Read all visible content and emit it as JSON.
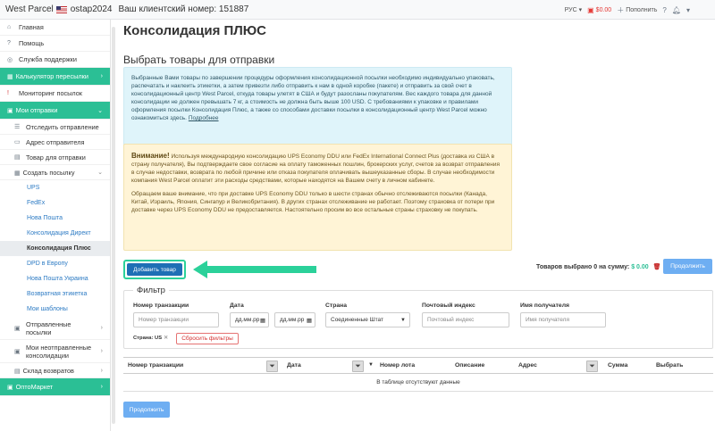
{
  "topbar": {
    "brand": "West Parcel",
    "username": "ostap2024",
    "account": "Ваш клиентский номер: 151887",
    "lang": "РУС",
    "balance": "$0.00",
    "topup": "Пополнить"
  },
  "sidebar": {
    "items": [
      {
        "label": "Главная",
        "icon": "home-icon"
      },
      {
        "label": "Помощь",
        "icon": "question-icon"
      },
      {
        "label": "Служба поддержки",
        "icon": "support-icon"
      },
      {
        "label": "Калькулятор пересылки",
        "icon": "calculator-icon"
      },
      {
        "label": "Мониторинг посылок",
        "icon": "alert-icon"
      },
      {
        "label": "Мои отправки",
        "icon": "box-icon"
      },
      {
        "label": "Отследить отправление",
        "icon": "track-icon"
      },
      {
        "label": "Адрес отправителя",
        "icon": "address-icon"
      },
      {
        "label": "Товар для отправки",
        "icon": "product-icon"
      },
      {
        "label": "Создать посылку",
        "icon": "package-icon"
      },
      {
        "label": "UPS"
      },
      {
        "label": "FedEx"
      },
      {
        "label": "Нова Пошта"
      },
      {
        "label": "Консолидация Директ"
      },
      {
        "label": "Консолидация Плюс"
      },
      {
        "label": "DPD в Европу"
      },
      {
        "label": "Нова Пошта Украина"
      },
      {
        "label": "Возвратная этикетка"
      },
      {
        "label": "Мои шаблоны"
      },
      {
        "label": "Отправленные посылки",
        "icon": "sent-icon"
      },
      {
        "label": "Мои неотправленные консолидации",
        "icon": "unsent-icon"
      },
      {
        "label": "Склад возвратов",
        "icon": "warehouse-icon"
      },
      {
        "label": "ОптоМаркет",
        "icon": "market-icon"
      }
    ]
  },
  "main": {
    "title": "Консолидация ПЛЮС",
    "subtitle": "Выбрать товары для отправки",
    "info_text": "Выбранные Вами товары по завершении процедуры оформления консолидационной посылки необходимо индивидуально упаковать, распечатать и наклеить этикетки, а затем привезти либо отправить к нам в одной коробке (пакете) и отправить за свой счет в консолидационный центр West Parcel, откуда товары улетят в США и будут разосланы покупателям. Вес каждого товара для данной консолидации не должен превышать 7 кг, а стоимость не должна быть выше 100 USD. С требованиями к упаковке и правилами оформления посылки Консолидация Плюс, а также со способами доставки посылки в консолидационный центр West Parcel можно ознакомиться здесь.",
    "info_link": "Подробнее",
    "warn_title": "Внимание!",
    "warn_text1": "Используя международную консолидацию UPS Economy DDU или FedEx International Connect Plus (доставка из США в страну получателя), Вы подтверждаете свое согласие на оплату таможенных пошлин, брокерских услуг, счетов за возврат отправления в случае недоставки, возврата по любой причине или отказа покупателя оплачивать вышеуказанные сборы. В случае необходимости компания West Parcel оплатит эти расходы средствами, которые находятся на Вашем счету в личном кабинете.",
    "warn_text2": "Обращаем ваше внимание, что при доставке UPS Economy DDU только в шести странах обычно отслеживаются посылки (Канада, Китай, Израиль, Япония, Сингапур и Великобритания). В других странах отслеживание не работает. Поэтому страховка от потери при доставке через UPS Economy DDU не предоставляется. Настоятельно просим во все остальные страны страховку не покупать.",
    "add_button": "Добавить товар",
    "selected_label": "Товаров выбрано 0 на сумму: ",
    "selected_amount": "$ 0.00",
    "continue_label": "Продолжить"
  },
  "filter": {
    "title": "Фильтр",
    "transaction_label": "Номер транзакции",
    "transaction_placeholder": "Номер транзакции",
    "date_label": "Дата",
    "date_from_placeholder": "дд.мм.рр",
    "date_to_placeholder": "дд.мм.рр",
    "country_label": "Страна",
    "country_value": "Соединенные Штат",
    "zip_label": "Почтовый индекс",
    "zip_placeholder": "Почтовый индекс",
    "recipient_label": "Имя получателя",
    "recipient_placeholder": "Имя получателя",
    "chip": "Страна: US",
    "reset": "Сбросить фильтры"
  },
  "table": {
    "columns": [
      "Номер транзакции",
      "Дата",
      "Номер лота",
      "Описание",
      "Адрес",
      "Сумма",
      "Выбрать"
    ],
    "empty": "В таблице отсутствуют данные"
  },
  "colors": {
    "accent": "#2bbf95",
    "primary": "#1e6fb5",
    "highlight": "#2bd19a"
  }
}
